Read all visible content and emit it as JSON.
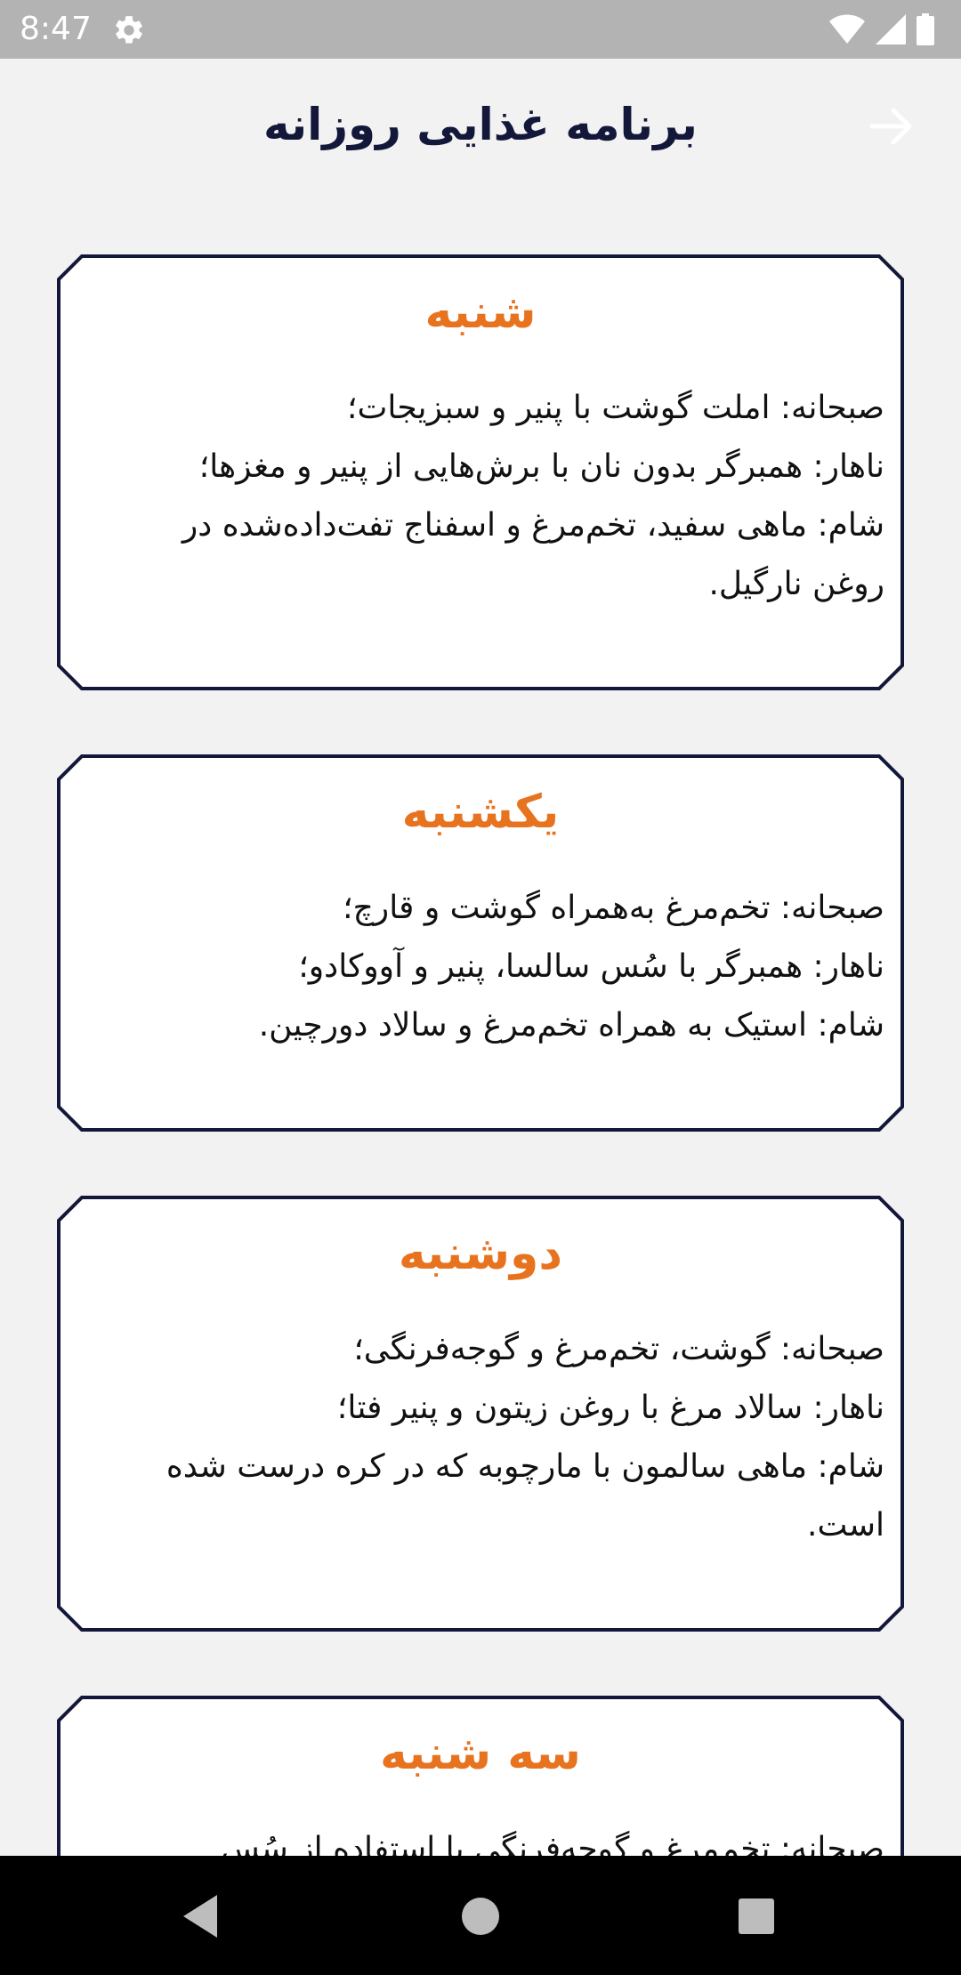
{
  "status_bar": {
    "time": "8:47",
    "icon_color": "#ffffff",
    "settings_icon": "gear-icon",
    "right_icons": [
      "wifi-icon",
      "cellular-signal-icon",
      "battery-icon"
    ]
  },
  "header": {
    "title": "برنامه غذایی روزانه",
    "back_icon": "arrow-right-icon",
    "title_color": "#13183a"
  },
  "theme": {
    "accent": "#e8731f",
    "card_border": "#13183a",
    "card_background": "#ffffff",
    "page_background": "#f2f2f2"
  },
  "days": [
    {
      "title": "شنبه",
      "lines": [
        "صبحانه: املت گوشت با پنیر و سبزیجات؛",
        "ناهار: همبرگر بدون نان با برش‌هایی از پنیر و مغزها؛",
        "شام: ماهی سفید، تخم‌مرغ و اسفناج تفت‌داده‌شده در",
        "روغن نارگیل."
      ]
    },
    {
      "title": "یکشنبه",
      "lines": [
        "صبحانه: تخم‌مرغ به‌همراه گوشت و قارچ؛",
        "ناهار: همبرگر با سُس سالسا، پنیر و آووکادو؛",
        "شام: استیک به همراه تخم‌مرغ و سالاد دورچین."
      ]
    },
    {
      "title": "دوشنبه",
      "lines": [
        "صبحانه: گوشت، تخم‌مرغ و گوجه‌فرنگی؛",
        "ناهار: سالاد مرغ با روغن زیتون و پنیر فتا؛",
        "شام: ماهی سالمون با مارچوبه که در کره درست شده",
        "است."
      ]
    },
    {
      "title": "سه شنبه",
      "lines": [
        "صبحانه: تخم‌مرغ و گوجه‌فرنگی با استفاده از سُس"
      ]
    }
  ],
  "nav_bar": {
    "buttons": [
      "back-triangle-icon",
      "home-circle-icon",
      "recents-square-icon"
    ]
  }
}
